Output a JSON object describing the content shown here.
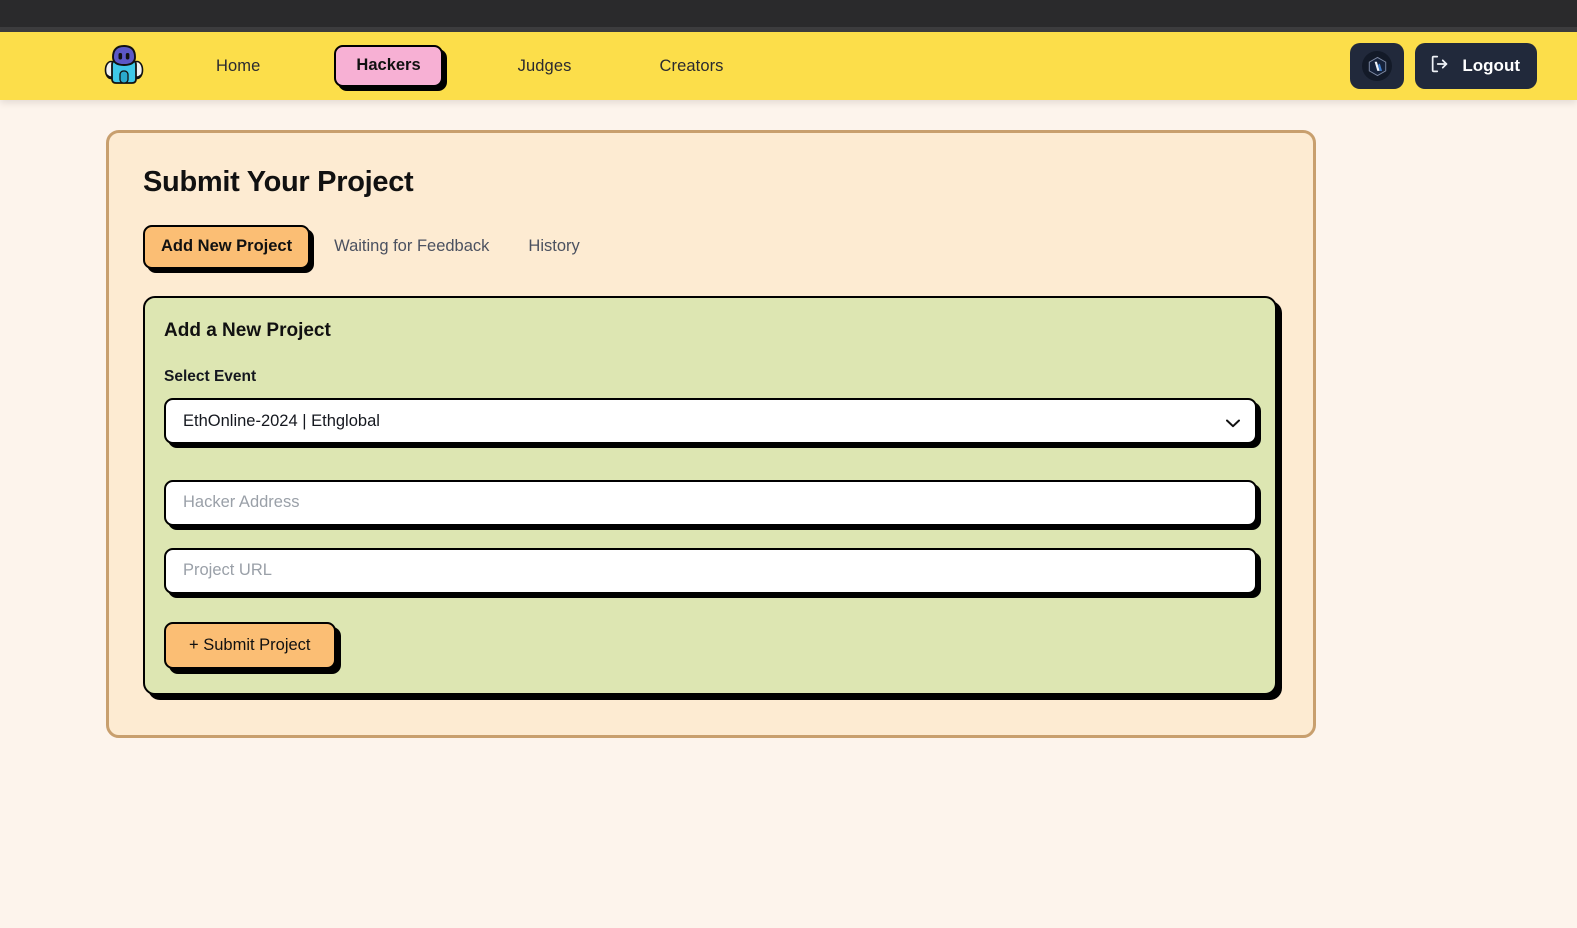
{
  "navbar": {
    "logo_icon": "robot-mascot-logo",
    "links": [
      {
        "label": "Home",
        "name": "nav-home",
        "active": false
      },
      {
        "label": "Hackers",
        "name": "nav-hackers",
        "active": true
      },
      {
        "label": "Judges",
        "name": "nav-judges",
        "active": false
      },
      {
        "label": "Creators",
        "name": "nav-creators",
        "active": false
      }
    ],
    "wallet_icon": "arbitrum-chain-icon",
    "logout_label": "Logout",
    "logout_icon": "logout-icon",
    "background_color": "#FCDE4A",
    "active_pill_color": "#F7B0D4"
  },
  "card": {
    "title": "Submit Your Project",
    "background_color": "#FDEBD2",
    "border_color": "#C89F6E"
  },
  "tabs": [
    {
      "label": "Add New Project",
      "name": "tab-add-new-project",
      "active": true
    },
    {
      "label": "Waiting for Feedback",
      "name": "tab-waiting-for-feedback",
      "active": false
    },
    {
      "label": "History",
      "name": "tab-history",
      "active": false
    }
  ],
  "form": {
    "heading": "Add a New Project",
    "select_event_label": "Select Event",
    "selected_event": "EthOnline-2024 | Ethglobal",
    "event_options": [
      "EthOnline-2024 | Ethglobal"
    ],
    "hacker_address_value": "",
    "hacker_address_placeholder": "Hacker Address",
    "project_url_value": "",
    "project_url_placeholder": "Project URL",
    "submit_label": "+ Submit Project",
    "panel_color": "#DDE6B2",
    "accent_color": "#FBBE74"
  }
}
